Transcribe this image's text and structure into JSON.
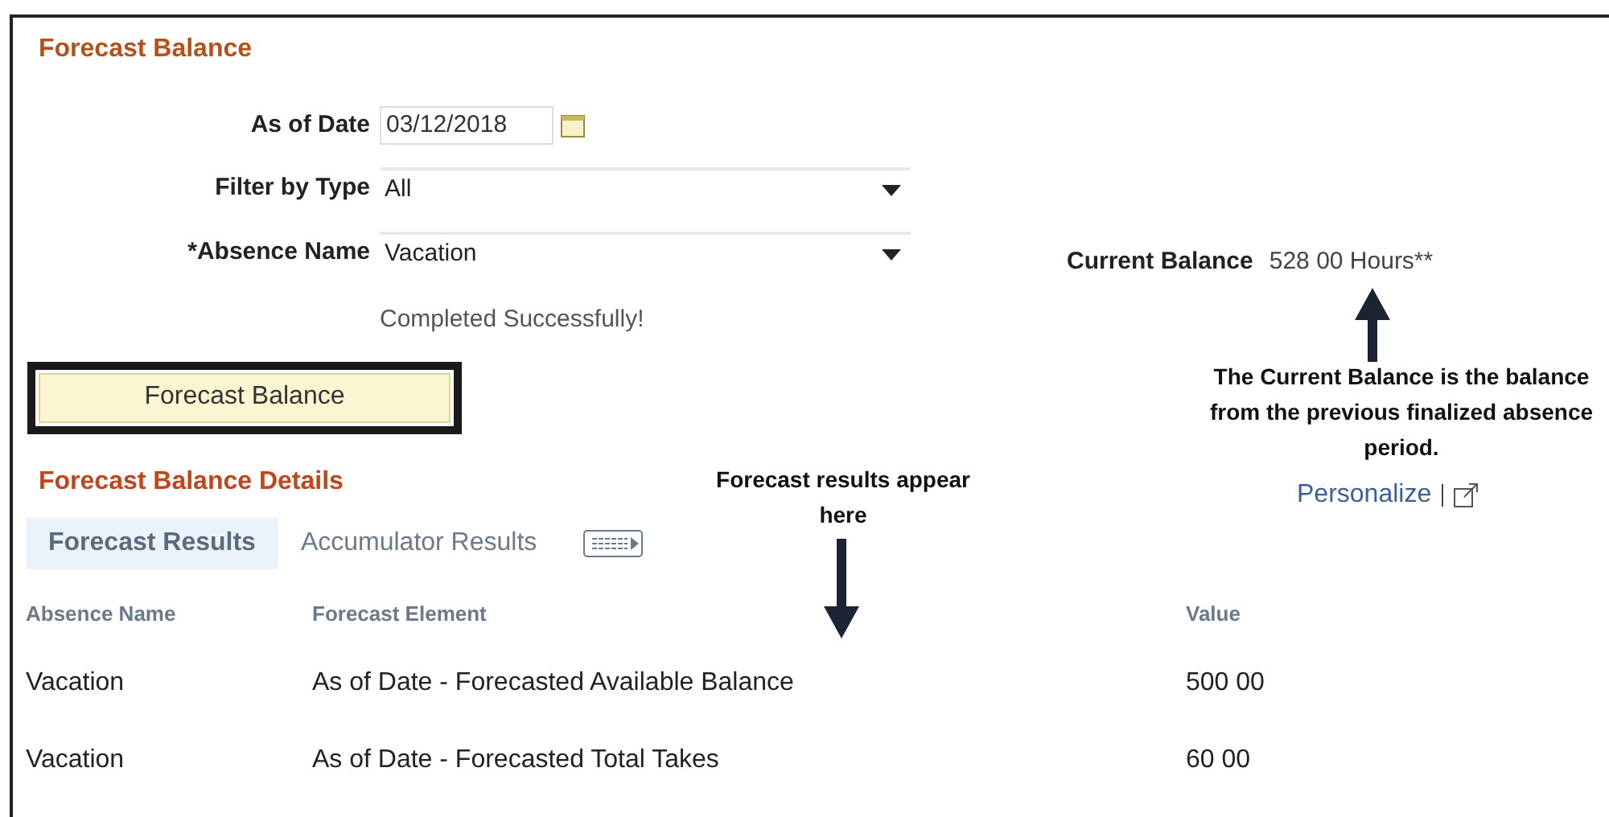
{
  "title": "Forecast Balance",
  "form": {
    "as_of_date": {
      "label": "As of Date",
      "value": "03/12/2018"
    },
    "filter_by_type": {
      "label": "Filter by Type",
      "value": "All"
    },
    "absence_name": {
      "label": "*Absence Name",
      "value": "Vacation"
    },
    "message": "Completed Successfully!",
    "button": "Forecast Balance"
  },
  "current_balance": {
    "label": "Current Balance",
    "value": "528 00 Hours**"
  },
  "annotations": [
    {
      "text": "The Current Balance is the balance from the previous finalized absence period.",
      "kind": "up"
    },
    {
      "text": "Forecast results appear here",
      "kind": "down"
    }
  ],
  "details": {
    "title": "Forecast Balance Details",
    "personalize": "Personalize",
    "tabs": [
      {
        "label": "Forecast Results",
        "selected": true
      },
      {
        "label": "Accumulator Results",
        "selected": false
      }
    ],
    "columns": [
      "Absence Name",
      "Forecast Element",
      "Value"
    ],
    "rows": [
      [
        "Vacation",
        "As of Date - Forecasted Available Balance",
        "500 00"
      ],
      [
        "Vacation",
        "As of Date - Forecasted Total Takes",
        "60 00"
      ]
    ]
  }
}
